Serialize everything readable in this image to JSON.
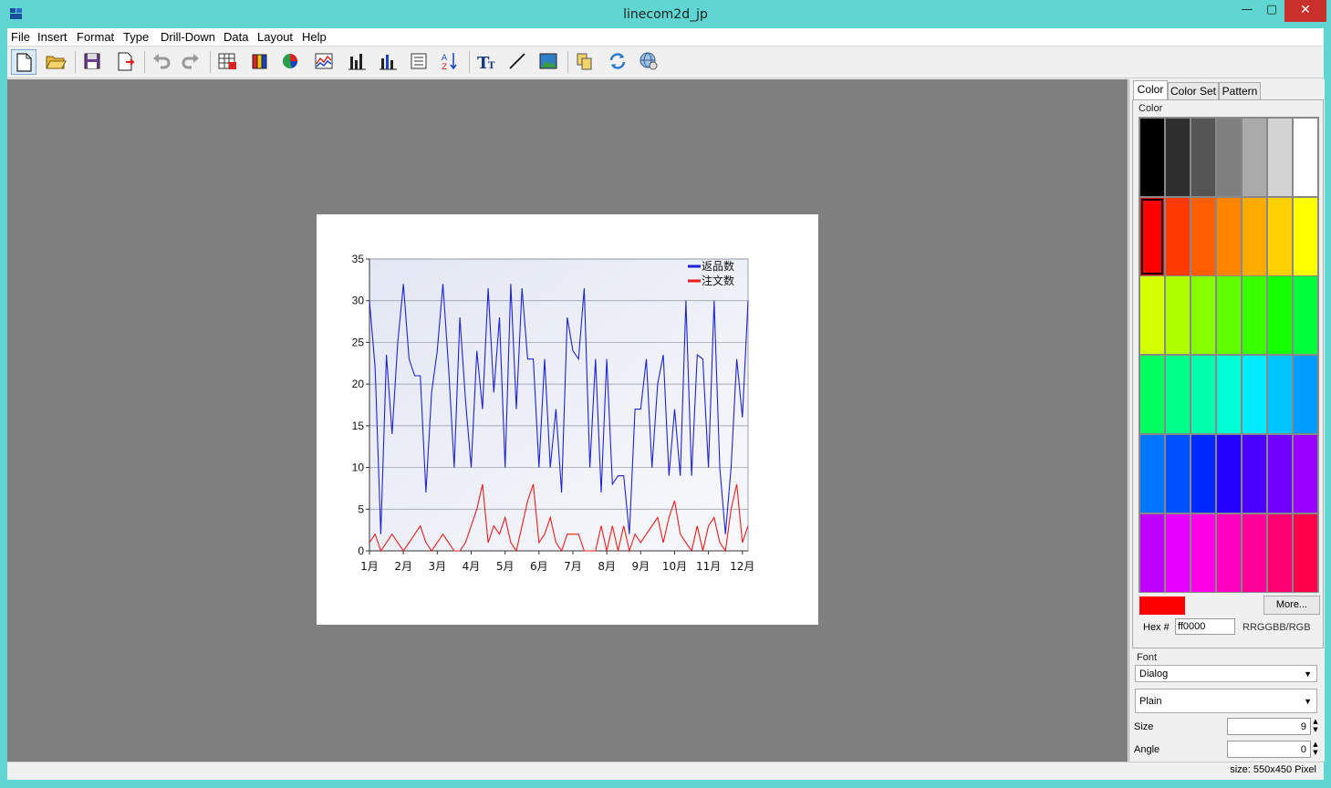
{
  "window": {
    "title": "linecom2d_jp",
    "close_glyph": "✕",
    "max_glyph": "▢",
    "min_glyph": "—"
  },
  "menu": [
    "File",
    "Insert",
    "Format",
    "Type",
    "Drill-Down",
    "Data",
    "Layout",
    "Help"
  ],
  "toolbar": {
    "icons": [
      "new-file-icon",
      "open-folder-icon",
      "save-icon",
      "export-icon",
      "undo-icon",
      "redo-icon",
      "table-icon",
      "bar-chart-icon",
      "pie-chart-icon",
      "line-chart-icon",
      "column-chart-icon",
      "stacked-chart-icon",
      "list-icon",
      "sort-az-icon",
      "text-icon",
      "line-tool-icon",
      "image-icon",
      "copy-icon",
      "refresh-icon",
      "settings-globe-icon"
    ]
  },
  "chart_data": {
    "type": "line",
    "title": "",
    "ylim": [
      0,
      35
    ],
    "yticks": [
      "0",
      "5",
      "10",
      "15",
      "20",
      "25",
      "30",
      "35"
    ],
    "xticks": [
      "1月",
      "2月",
      "3月",
      "4月",
      "5月",
      "6月",
      "7月",
      "8月",
      "9月",
      "10月",
      "11月",
      "12月"
    ],
    "points_per_month": 6,
    "grid": "horizontal",
    "legend_position": "top-right",
    "series": [
      {
        "name": "返品数",
        "color": "#1f22d6",
        "values": [
          30,
          22,
          2,
          23.5,
          14,
          25,
          32,
          23,
          21,
          21,
          7,
          19,
          24,
          32,
          22,
          10,
          28,
          18,
          10,
          24,
          17,
          31.5,
          19,
          28,
          10,
          32,
          17,
          31.5,
          23,
          23,
          10,
          23,
          10,
          17,
          7,
          28,
          24,
          23,
          31.5,
          10,
          23,
          7,
          23,
          8,
          9,
          9,
          2,
          17,
          17,
          23,
          10,
          20,
          23.5,
          9,
          17,
          9,
          30,
          9,
          23.5,
          23,
          10,
          30,
          10,
          2,
          10,
          23,
          16,
          30
        ]
      },
      {
        "name": "注文数",
        "color": "#ee1c1c",
        "values": [
          1,
          2,
          0,
          1,
          2,
          1,
          0,
          1,
          2,
          3,
          1,
          0,
          1,
          2,
          1,
          0,
          0,
          1,
          3,
          5,
          8,
          1,
          3,
          2,
          4,
          1,
          0,
          3,
          6,
          8,
          1,
          2,
          4,
          1,
          0,
          2,
          2,
          2,
          0,
          0,
          0,
          3,
          0,
          3,
          0,
          3,
          0,
          2,
          1,
          2,
          3,
          4,
          1,
          4,
          6,
          2,
          1,
          0,
          3,
          0,
          3,
          4,
          1,
          0,
          5,
          8,
          1,
          3
        ]
      }
    ]
  },
  "panel": {
    "tabs": [
      "Color",
      "Color Set",
      "Pattern"
    ],
    "group_label": "Color",
    "swatches": [
      [
        "#000000",
        "#2e2e2e",
        "#555555",
        "#7f7f7f",
        "#aaaaaa",
        "#d3d3d3",
        "#ffffff"
      ],
      [
        "#ff0000",
        "#ff3a00",
        "#ff5f00",
        "#ff8500",
        "#ffab00",
        "#ffd100",
        "#ffff00"
      ],
      [
        "#d4ff00",
        "#adff00",
        "#86ff00",
        "#5fff00",
        "#39ff00",
        "#12ff00",
        "#00ff3a"
      ],
      [
        "#00ff5f",
        "#00ff86",
        "#00ffad",
        "#00ffd4",
        "#00ebff",
        "#00c4ff",
        "#009dff"
      ],
      [
        "#0076ff",
        "#0050ff",
        "#0029ff",
        "#2400ff",
        "#4b00ff",
        "#7100ff",
        "#9800ff"
      ],
      [
        "#bf00ff",
        "#e600ff",
        "#ff00e6",
        "#ff00bf",
        "#ff0098",
        "#ff0071",
        "#ff004b"
      ]
    ],
    "selected_color": "#ff0000",
    "more_label": "More...",
    "hex_label": "Hex #",
    "hex_value": "ff0000",
    "hex_format": "RRGGBB/RGB",
    "font_group": "Font",
    "font_family": "Dialog",
    "font_style": "Plain",
    "size_label": "Size",
    "size_value": "9",
    "angle_label": "Angle",
    "angle_value": "0"
  },
  "status": "size: 550x450 Pixel"
}
